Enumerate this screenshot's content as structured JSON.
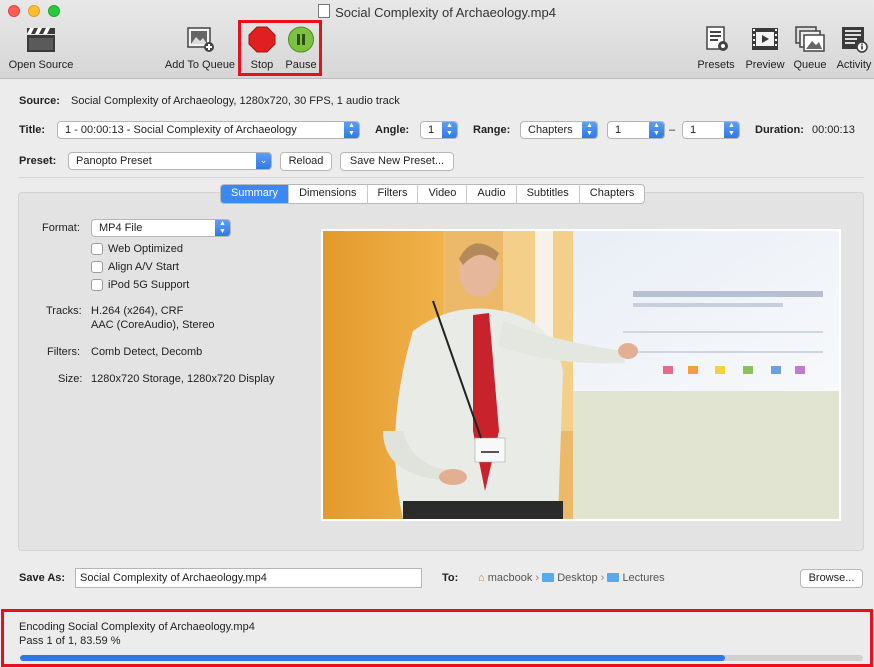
{
  "window": {
    "title": "Social Complexity of Archaeology.mp4"
  },
  "toolbar": {
    "open_source": "Open Source",
    "add_to_queue": "Add To Queue",
    "stop": "Stop",
    "pause": "Pause",
    "presets": "Presets",
    "preview": "Preview",
    "queue": "Queue",
    "activity": "Activity"
  },
  "source": {
    "label": "Source:",
    "value": "Social Complexity of Archaeology, 1280x720, 30 FPS, 1 audio track"
  },
  "title_row": {
    "title_label": "Title:",
    "title_value": "1 - 00:00:13 - Social Complexity of Archaeology",
    "angle_label": "Angle:",
    "angle_value": "1",
    "range_label": "Range:",
    "range_type": "Chapters",
    "range_start": "1",
    "range_sep": "–",
    "range_end": "1",
    "duration_label": "Duration:",
    "duration_value": "00:00:13"
  },
  "preset_row": {
    "label": "Preset:",
    "value": "Panopto Preset",
    "reload": "Reload",
    "save_new": "Save New Preset..."
  },
  "tabs": [
    "Summary",
    "Dimensions",
    "Filters",
    "Video",
    "Audio",
    "Subtitles",
    "Chapters"
  ],
  "summary": {
    "format_label": "Format:",
    "format_value": "MP4 File",
    "web_optimized": "Web Optimized",
    "align_av": "Align A/V Start",
    "ipod": "iPod 5G Support",
    "tracks_label": "Tracks:",
    "tracks_video": "H.264 (x264), CRF",
    "tracks_audio": "AAC (CoreAudio), Stereo",
    "filters_label": "Filters:",
    "filters_value": "Comb Detect, Decomb",
    "size_label": "Size:",
    "size_value": "1280x720 Storage, 1280x720 Display"
  },
  "save": {
    "label": "Save As:",
    "filename": "Social Complexity of Archaeology.mp4",
    "to_label": "To:",
    "path": [
      "macbook",
      "Desktop",
      "Lectures"
    ],
    "browse": "Browse..."
  },
  "status": {
    "line1": "Encoding Social Complexity of Archaeology.mp4",
    "line2": "Pass 1 of 1, 83.59 %",
    "progress_percent": 83.59
  },
  "colors": {
    "highlight": "#e8101a",
    "accent": "#3b87f3",
    "stop": "#e02020",
    "pause": "#5fae2e"
  }
}
